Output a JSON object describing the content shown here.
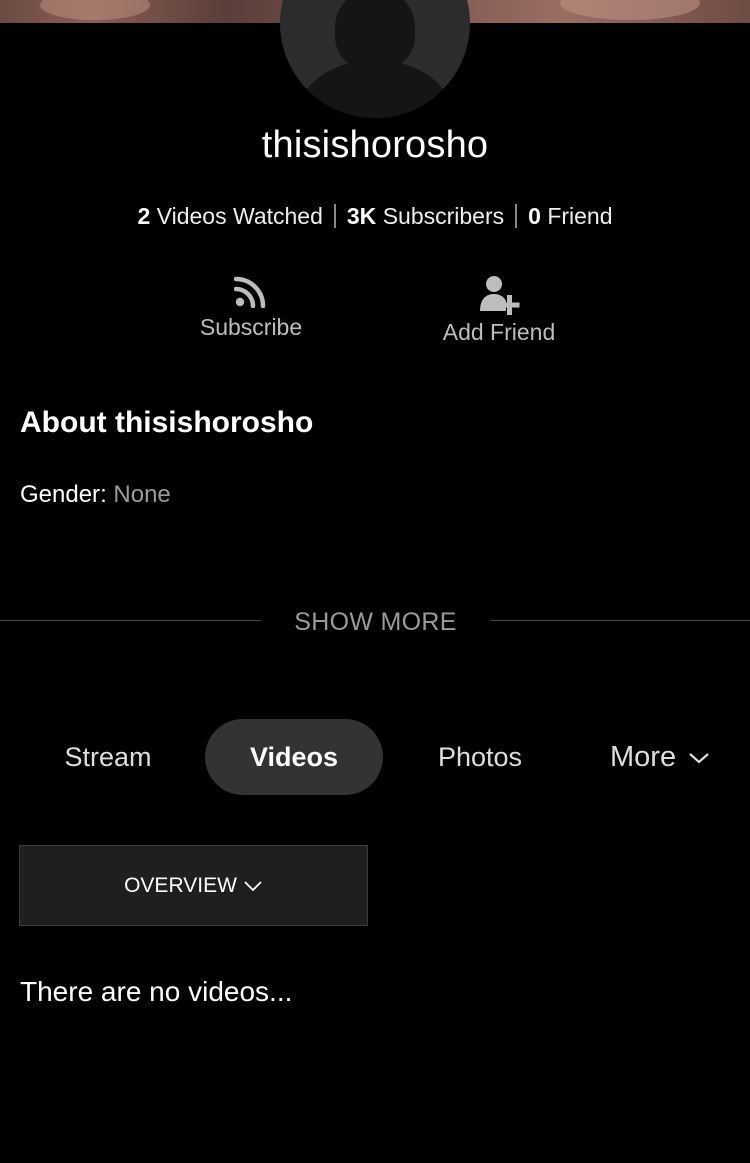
{
  "profile": {
    "username": "thisishorosho",
    "stats": {
      "videos_watched_count": "2",
      "videos_watched_label": "Videos Watched",
      "subscribers_count": "3K",
      "subscribers_label": "Subscribers",
      "friends_count": "0",
      "friends_label": "Friend"
    }
  },
  "actions": {
    "subscribe_label": "Subscribe",
    "subscribe_icon": "rss-icon",
    "add_friend_label": "Add Friend",
    "add_friend_icon": "add-user-icon"
  },
  "about": {
    "title": "About thisishorosho",
    "gender_label": "Gender",
    "gender_value": "None",
    "show_more_label": "SHOW MORE"
  },
  "tabs": [
    {
      "label": "Stream",
      "active": false
    },
    {
      "label": "Videos",
      "active": true
    },
    {
      "label": "Photos",
      "active": false
    },
    {
      "label": "More",
      "active": false
    }
  ],
  "filter": {
    "selected": "OVERVIEW"
  },
  "content": {
    "empty_message": "There are no videos..."
  },
  "colors": {
    "background": "#000000",
    "active_tab_bg": "#333333",
    "muted_text": "#9a9a9a"
  }
}
